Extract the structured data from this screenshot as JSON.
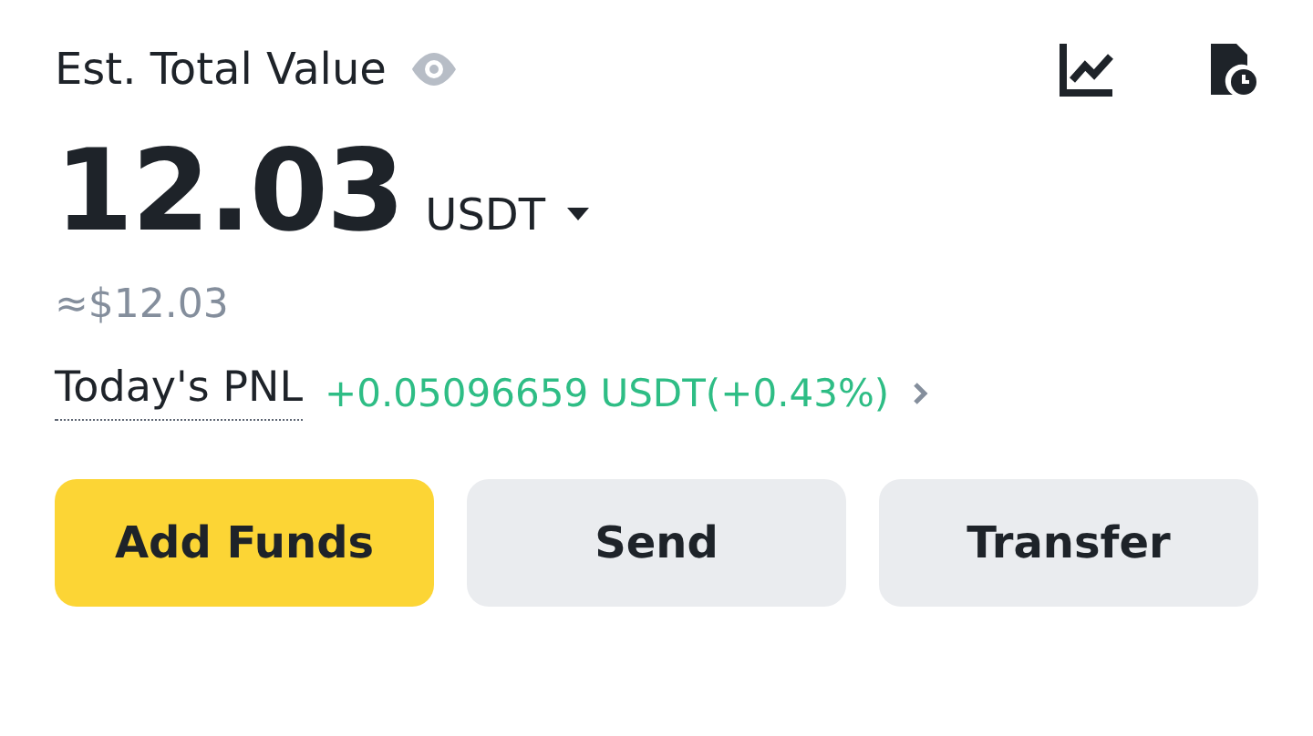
{
  "header": {
    "title": "Est. Total Value"
  },
  "balance": {
    "amount": "12.03",
    "currency": "USDT",
    "fiat": "≈$12.03"
  },
  "pnl": {
    "label": "Today's PNL",
    "value": "+0.05096659 USDT(+0.43%)",
    "positive": true
  },
  "buttons": [
    {
      "label": "Add Funds",
      "kind": "primary"
    },
    {
      "label": "Send",
      "kind": "secondary"
    },
    {
      "label": "Transfer",
      "kind": "secondary"
    }
  ]
}
